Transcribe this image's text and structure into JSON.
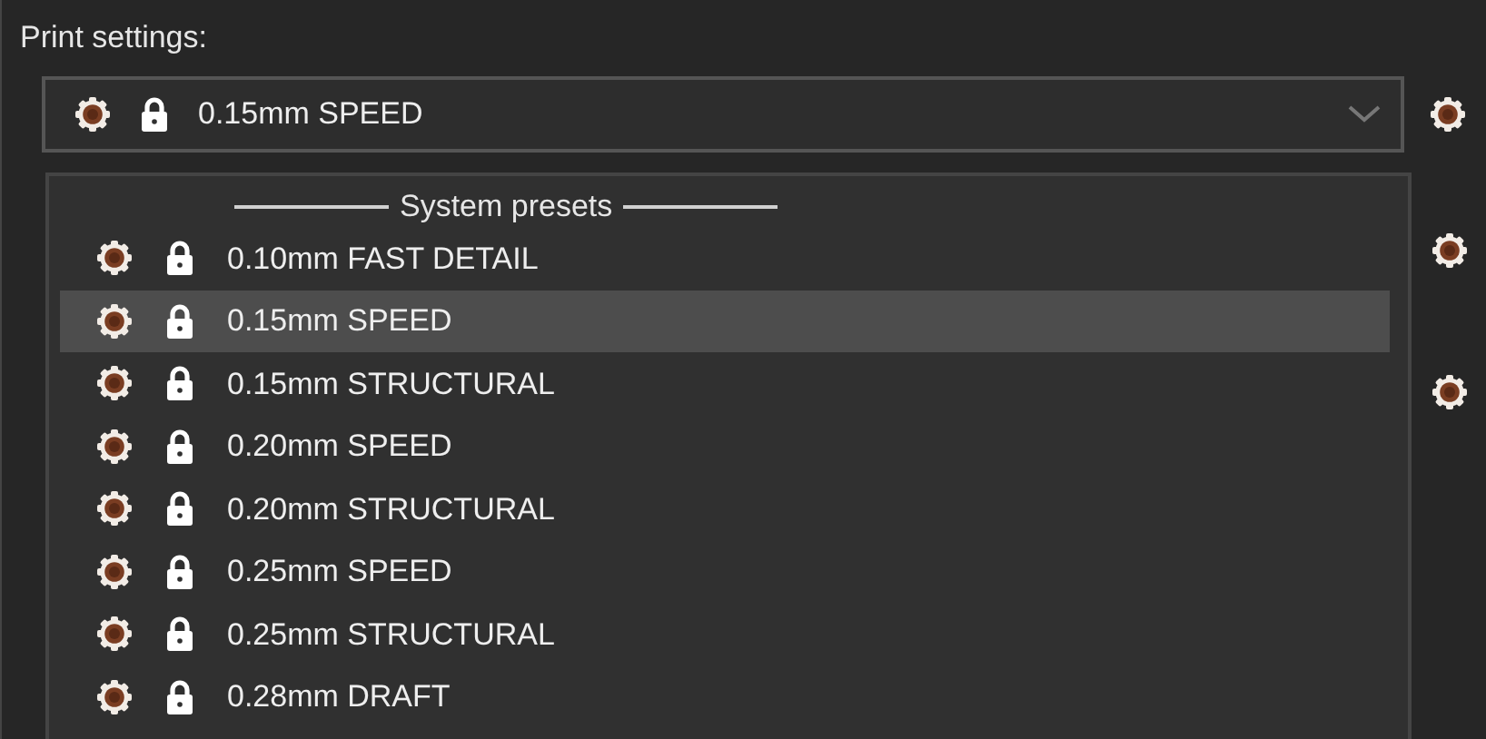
{
  "section_label": "Print settings:",
  "preset_combo": {
    "value": "0.15mm SPEED",
    "expanded": true
  },
  "preset_list": {
    "header": "System presets",
    "items": [
      {
        "label": "0.10mm FAST DETAIL",
        "selected": false
      },
      {
        "label": "0.15mm SPEED",
        "selected": true
      },
      {
        "label": "0.15mm STRUCTURAL",
        "selected": false
      },
      {
        "label": "0.20mm SPEED",
        "selected": false
      },
      {
        "label": "0.20mm STRUCTURAL",
        "selected": false
      },
      {
        "label": "0.25mm SPEED",
        "selected": false
      },
      {
        "label": "0.25mm STRUCTURAL",
        "selected": false
      },
      {
        "label": "0.28mm DRAFT",
        "selected": false
      }
    ]
  }
}
